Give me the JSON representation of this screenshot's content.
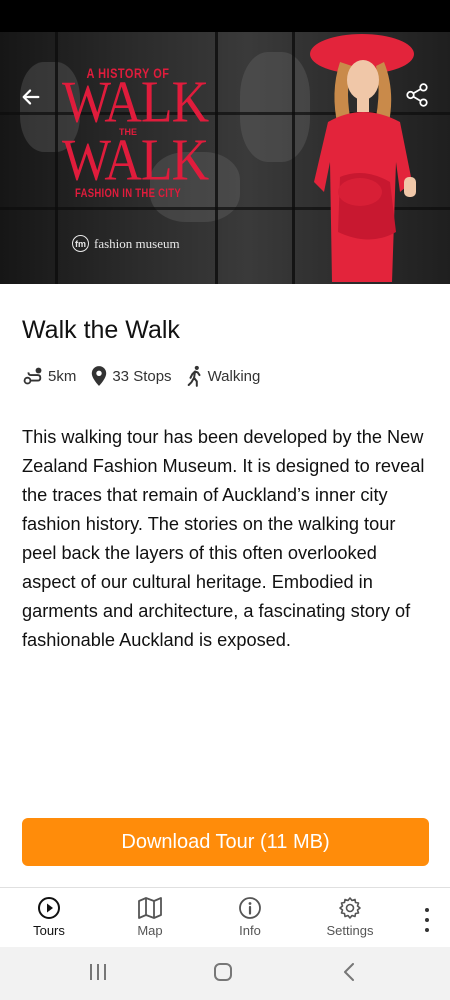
{
  "hero": {
    "poster_top": "A HISTORY OF",
    "poster_walk1": "WALK",
    "poster_the": "THE",
    "poster_walk2": "WALK",
    "poster_sub": "FASHION IN THE CITY",
    "museum_mark": "fm",
    "museum_name": "fashion museum"
  },
  "tour": {
    "title": "Walk the Walk",
    "distance": "5km",
    "stops": "33 Stops",
    "mode": "Walking",
    "description": "This walking tour has been developed by the New Zealand Fashion Museum. It is designed to reveal the traces that remain of Auckland’s inner city fashion history. The stories on the walking tour peel back the layers of this often overlooked aspect of our cultural heritage. Embodied in garments and architecture, a fascinating story of fashionable Auckland is exposed.",
    "download_label": "Download Tour (11 MB)"
  },
  "nav": {
    "tours": "Tours",
    "map": "Map",
    "info": "Info",
    "settings": "Settings"
  },
  "colors": {
    "accent": "#ff8c0a",
    "poster_red": "#e01c3c",
    "dress_red": "#e3243b"
  },
  "icons": [
    "back-arrow-icon",
    "share-icon",
    "route-icon",
    "location-pin-icon",
    "walking-icon",
    "play-circle-icon",
    "map-icon",
    "info-icon",
    "gear-icon",
    "more-vert-icon"
  ]
}
